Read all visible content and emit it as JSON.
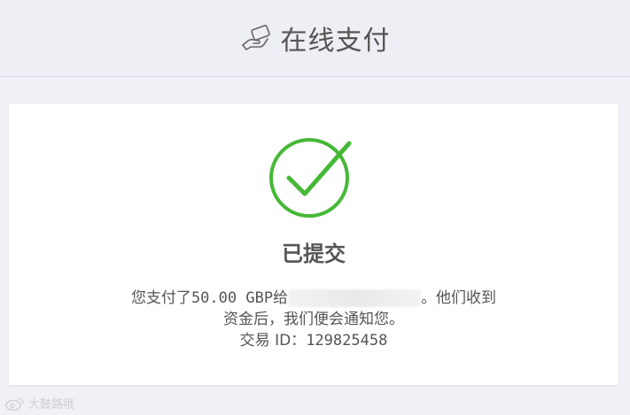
{
  "header": {
    "title": "在线支付",
    "icon": "hand-card-payment-icon"
  },
  "result": {
    "icon": "check-circle-icon",
    "check_color": "#46b837",
    "status": "已提交",
    "message_prefix": "您支付了",
    "amount": "50.00 GBP",
    "message_to": "给",
    "message_suffix": "。他们收到",
    "message_line2": "资金后，我们便会通知您。",
    "transaction_label": "交易 ID：",
    "transaction_id": "129825458"
  },
  "watermark": {
    "icon": "weibo-logo-icon",
    "text": "大鼓路哦"
  }
}
